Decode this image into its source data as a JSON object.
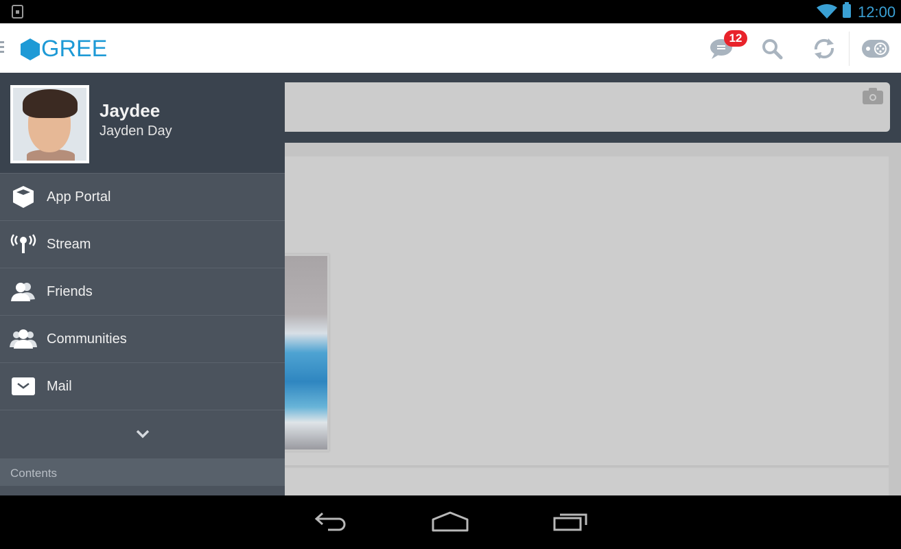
{
  "status_bar": {
    "time": "12:00",
    "icons": [
      "notification-icon",
      "wifi-icon",
      "battery-icon"
    ]
  },
  "app_bar": {
    "logo_text": "GREE",
    "brand_color": "#1e9ad6",
    "notification_count": "12",
    "actions": [
      "messages-icon",
      "search-icon",
      "refresh-icon",
      "games-controller-icon"
    ]
  },
  "drawer": {
    "profile": {
      "nickname": "Jaydee",
      "full_name": "Jayden Day"
    },
    "items": [
      {
        "label": "App Portal",
        "icon": "app-portal-cube-icon"
      },
      {
        "label": "Stream",
        "icon": "stream-broadcast-icon"
      },
      {
        "label": "Friends",
        "icon": "friends-icon"
      },
      {
        "label": "Communities",
        "icon": "communities-icon"
      },
      {
        "label": "Mail",
        "icon": "mail-icon"
      }
    ],
    "expand_icon": "chevron-down-icon",
    "section_header": "Contents"
  },
  "main": {
    "composer_icon": "camera-icon"
  },
  "system_nav": [
    "back-icon",
    "home-icon",
    "recents-icon"
  ]
}
